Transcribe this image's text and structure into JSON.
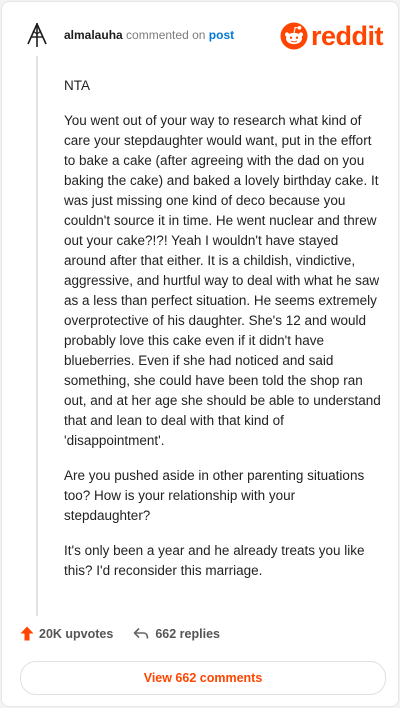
{
  "comment": {
    "username": "almalauha",
    "commented_text": "commented on",
    "post_link": "post",
    "paragraphs": [
      "NTA",
      "You went out of your way to research what kind of care your stepdaughter would want, put in the effort to bake a cake (after agreeing with the dad on you baking the cake) and baked a lovely birthday cake. It was just missing one kind of deco because you couldn't source it in time. He went nuclear and threw out your cake?!?! Yeah I wouldn't have stayed around after that either. It is a childish, vindictive, aggressive, and hurtful way to deal with what he saw as a less than perfect situation. He seems extremely overprotective of his daughter. She's 12 and would probably love this cake even if it didn't have blueberries. Even if she had noticed and said something, she could have been told the shop ran out, and at her age she should be able to understand that and lean to deal with that kind of 'disappointment'.",
      "Are you pushed aside in other parenting situations too? How is your relationship with your stepdaughter?",
      "It's only been a year and he already treats you like this? I'd reconsider this marriage."
    ]
  },
  "brand": {
    "logo_text": "reddit",
    "color": "#ff4500"
  },
  "footer": {
    "upvotes": "20K upvotes",
    "replies": "662 replies",
    "view_comments": "View 662 comments"
  },
  "icons": {
    "avatar": "avatar-icon",
    "upvote": "upvote-arrow-icon",
    "reply": "reply-arrow-icon",
    "logo": "reddit-snoo-icon"
  }
}
